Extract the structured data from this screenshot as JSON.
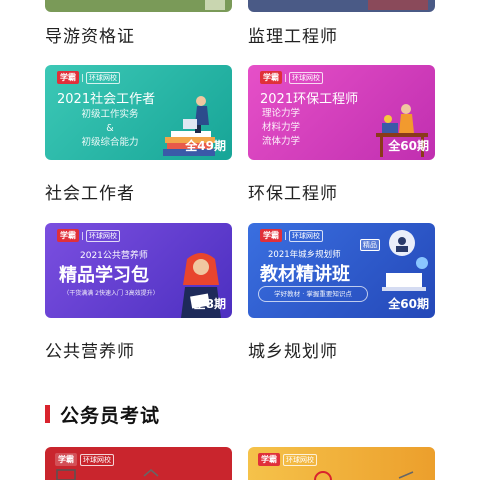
{
  "row0": {
    "left_title": "导游资格证",
    "right_title": "监理工程师"
  },
  "cards": [
    {
      "brand": "学霸",
      "brand_tag": "环球网校",
      "headline": "2021社会工作者",
      "lines": [
        "初级工作实务",
        "&",
        "初级综合能力"
      ],
      "count": "全49期",
      "title": "社会工作者",
      "color": "#1fb6a6"
    },
    {
      "brand": "学霸",
      "brand_tag": "环球网校",
      "headline": "2021环保工程师",
      "lines": [
        "理论力学",
        "材料力学",
        "流体力学"
      ],
      "count": "全60期",
      "title": "环保工程师",
      "color": "#d63fbf"
    },
    {
      "brand": "学霸",
      "brand_tag": "环球网校",
      "headline": "2021公共营养师",
      "big": "精品学习包",
      "small": "（干货满满 2快速入门 3高效提升）",
      "count": "全8期",
      "title": "公共营养师",
      "color": "#5b3fcf"
    },
    {
      "brand": "学霸",
      "brand_tag": "环球网校",
      "badge": "精品",
      "headline": "2021年城乡规划师",
      "big": "教材精讲班",
      "small": "学好教材 · 掌握重要知识点",
      "count": "全60期",
      "title": "城乡规划师",
      "color": "#2f5fd1"
    }
  ],
  "section": {
    "title": "公务员考试"
  },
  "peek_cards": [
    {
      "brand": "学霸",
      "brand_tag": "环球网校",
      "color": "#c9252d"
    },
    {
      "brand": "学霸",
      "brand_tag": "环球网校",
      "color": "#f0b33c"
    }
  ],
  "bottom_nav": [
    "home-icon",
    "back-icon",
    "search-icon",
    "forward-icon"
  ]
}
